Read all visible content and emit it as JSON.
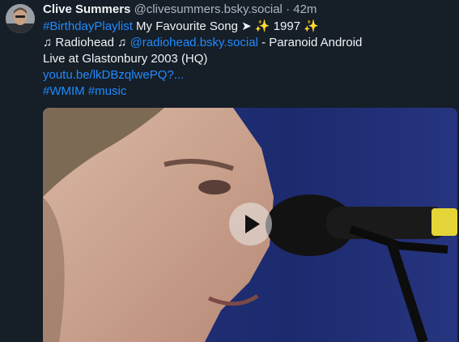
{
  "post": {
    "author_name": "Clive Summers",
    "author_handle": "@clivesummers.bsky.social",
    "separator": "·",
    "time": "42m",
    "text": {
      "hashtag_birthday": "#BirthdayPlaylist",
      "favourite": " My Favourite Song ➤ ",
      "sparkle1": "✨",
      "year": " 1997 ",
      "sparkle2": "✨",
      "note_open": "♫ Radiohead ♫ ",
      "mention": "@radiohead.bsky.social",
      "song": " - Paranoid Android",
      "live": "Live at Glastonbury 2003 (HQ)",
      "link": "youtu.be/lkDBzqlwePQ?...",
      "hashtag_wmim": "#WMIM",
      "hashtag_music": "#music"
    }
  },
  "icons": {
    "play": "play-icon"
  },
  "colors": {
    "background": "#161e27",
    "link": "#208bfe",
    "muted": "#aeb7c2"
  }
}
